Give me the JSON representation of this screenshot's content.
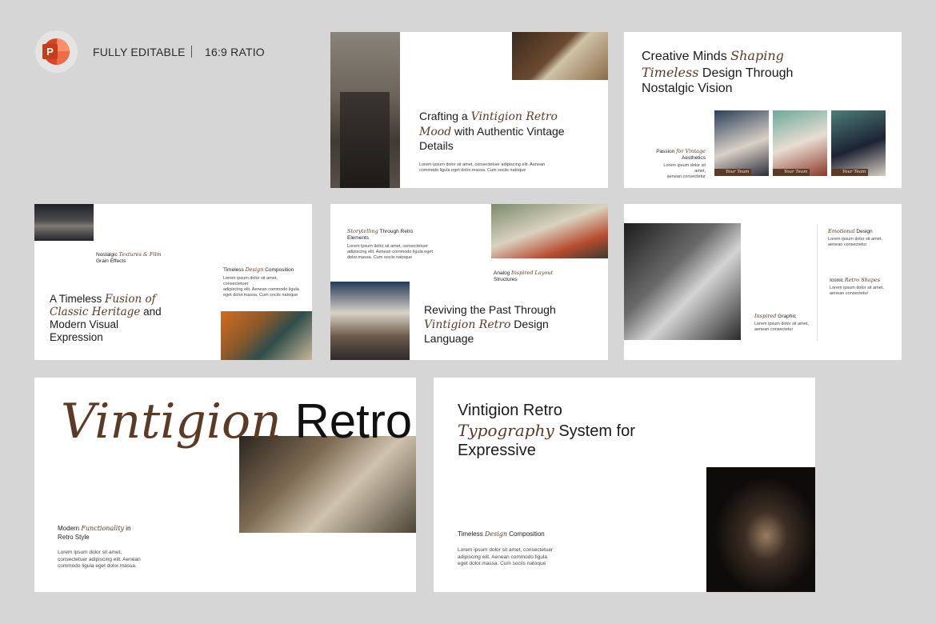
{
  "header": {
    "app_icon": "powerpoint-icon",
    "app_letter": "P",
    "editable_label": "FULLY EDITABLE",
    "ratio_label": "16:9 RATIO"
  },
  "colors": {
    "accent_brown": "#5b3a26",
    "background": "#d6d6d6"
  },
  "lorem_2line": "Lorem ipsum dolor sit amet, consectetuer adipiscing elit. Aenean commodo ligula eget dolor.massa. Cum sociis natoque",
  "slides": {
    "s1": {
      "title_pre": "Crafting a ",
      "title_it": "Vintigion Retro Mood",
      "title_post": " with Authentic Vintage Details",
      "body_a": "Lorem ipsum dolor sit amet, consectetuer adipiscing elit. Aenean",
      "body_b": "commodo ligula eget dolor.massa. Cum sociis natoque"
    },
    "s2": {
      "title_a": "Creative Minds ",
      "title_it1": "Shaping",
      "title_it2": "Timeless",
      "title_b": " Design Through",
      "title_c": "Nostalgic Vision",
      "label_a": "Passion ",
      "label_it": "for Vintage",
      "label_b": "Aesthetics",
      "body_a": "Lorem ipsum dolor sit amet,",
      "body_b": "aenean consectetur",
      "teams": [
        "Your Team",
        "Your Team",
        "Your Team"
      ]
    },
    "s3": {
      "label1_a": "Nostalgic ",
      "label1_it": "Textures & Film",
      "label1_b": "Grain Effects",
      "label2_a": "Timeless ",
      "label2_it": "Design",
      "label2_b": " Composition",
      "body_a": "Lorem ipsum dolor sit amet, consectetuer",
      "body_b": "adipiscing elit. Aenean commodo ligula",
      "body_c": "eget dolor.massa. Cum sociis natoque",
      "title_a": "A Timeless ",
      "title_it1": "Fusion of",
      "title_it2": "Classic Heritage",
      "title_b": " and",
      "title_c": "Modern Visual",
      "title_d": "Expression"
    },
    "s4": {
      "label1_it": "Storytelling",
      "label1_a": " Through Retro",
      "label1_b": "Elements",
      "body_a": "Lorem ipsum dolor sit amet, consectetuer",
      "body_b": "adipiscing elit. Aenean commodo ligula eget",
      "body_c": "dolor.massa. Cum sociis natoque",
      "label2_a": "Analog ",
      "label2_it": "Inspired Layout",
      "label2_b": "Structures",
      "title_a": "Reviving the Past Through",
      "title_it": "Vintigion Retro",
      "title_b": " Design",
      "title_c": "Language"
    },
    "s5": {
      "label1_it": "Emotional",
      "label1_a": " Design",
      "label2_a": "Iconic ",
      "label2_it": "Retro Shapes",
      "label3_it": "Inspired",
      "label3_a": " Graphic",
      "body_a": "Lorem ipsum dolor sit amet,",
      "body_b": "aenean consectetur"
    },
    "s6": {
      "title_it": "Vintigion",
      "title_b": "Retro",
      "label_a": "Modern ",
      "label_it": "Functionality",
      "label_b": " in",
      "label_c": "Retro Style",
      "body_a": "Lorem ipsum dolor sit amet,",
      "body_b": "consectetuer adipiscing elit. Aenean",
      "body_c": "commodo ligula eget dolor.massa."
    },
    "s7": {
      "title_a": "Vintigion Retro",
      "title_it": "Typography",
      "title_b": " System for",
      "title_c": "Expressive",
      "label_a": "Timeless ",
      "label_it": "Design",
      "label_b": " Composition",
      "body_a": "Lorem ipsum dolor sit amet, consectetuer",
      "body_b": "adipiscing elit. Aenean commodo ligula",
      "body_c": "eget dolor.massa. Cum sociis natoque"
    }
  }
}
